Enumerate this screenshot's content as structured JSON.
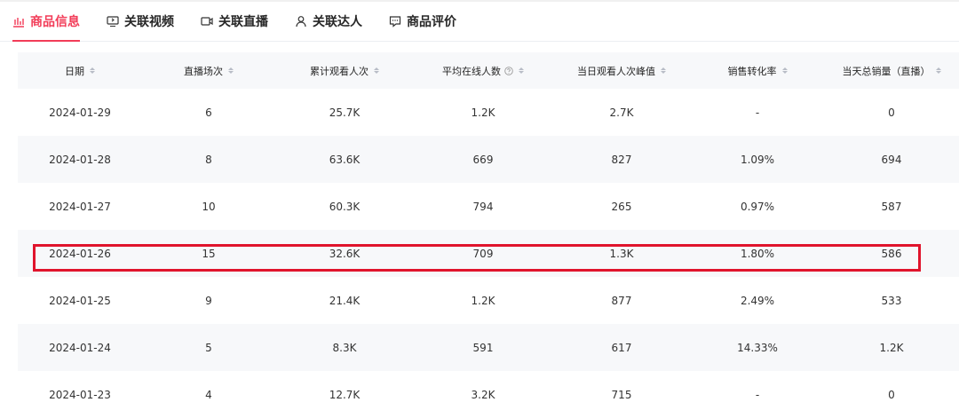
{
  "tabs": [
    {
      "label": "商品信息",
      "icon": "bar-chart-icon"
    },
    {
      "label": "关联视频",
      "icon": "monitor-icon"
    },
    {
      "label": "关联直播",
      "icon": "camera-icon"
    },
    {
      "label": "关联达人",
      "icon": "user-icon"
    },
    {
      "label": "商品评价",
      "icon": "comment-icon"
    }
  ],
  "table": {
    "headers": [
      "日期",
      "直播场次",
      "累计观看人次",
      "平均在线人数",
      "当日观看人次峰值",
      "销售转化率",
      "当天总销量（直播）"
    ],
    "rows": [
      [
        "2024-01-29",
        "6",
        "25.7K",
        "1.2K",
        "2.7K",
        "-",
        "0"
      ],
      [
        "2024-01-28",
        "8",
        "63.6K",
        "669",
        "827",
        "1.09%",
        "694"
      ],
      [
        "2024-01-27",
        "10",
        "60.3K",
        "794",
        "265",
        "0.97%",
        "587"
      ],
      [
        "2024-01-26",
        "15",
        "32.6K",
        "709",
        "1.3K",
        "1.80%",
        "586"
      ],
      [
        "2024-01-25",
        "9",
        "21.4K",
        "1.2K",
        "877",
        "2.49%",
        "533"
      ],
      [
        "2024-01-24",
        "5",
        "8.3K",
        "591",
        "617",
        "14.33%",
        "1.2K"
      ],
      [
        "2024-01-23",
        "4",
        "12.7K",
        "3.2K",
        "715",
        "-",
        "0"
      ]
    ]
  },
  "colors": {
    "accent": "#f23c58",
    "highlight_border": "#e0142c",
    "alt_row": "#f7f8fa"
  }
}
